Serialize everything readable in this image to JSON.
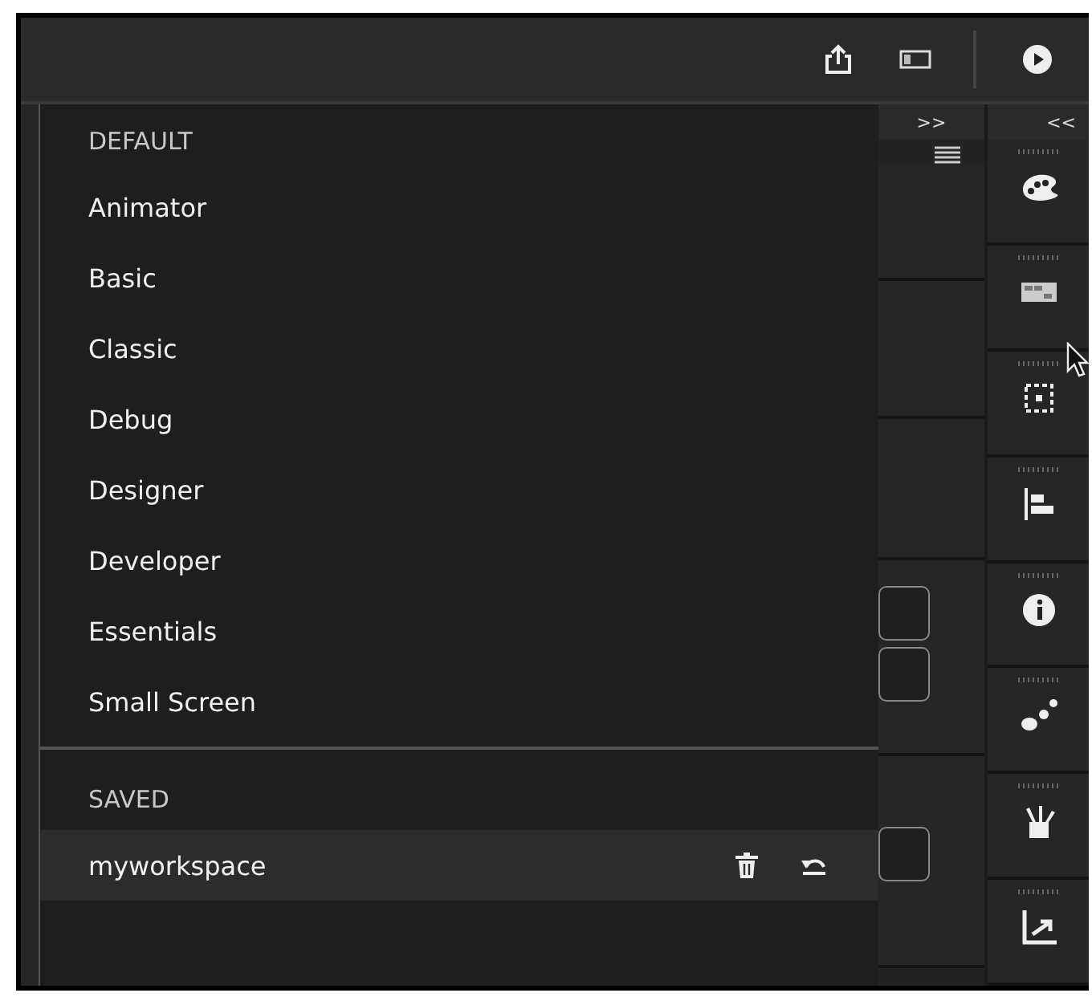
{
  "workspace_menu": {
    "sections": [
      {
        "heading": "DEFAULT",
        "items": [
          {
            "label": "Animator",
            "selected": false
          },
          {
            "label": "Basic",
            "selected": false
          },
          {
            "label": "Classic",
            "selected": false
          },
          {
            "label": "Debug",
            "selected": false
          },
          {
            "label": "Designer",
            "selected": false
          },
          {
            "label": "Developer",
            "selected": false
          },
          {
            "label": "Essentials",
            "selected": false
          },
          {
            "label": "Small Screen",
            "selected": false
          }
        ]
      },
      {
        "heading": "SAVED",
        "items": [
          {
            "label": "myworkspace",
            "selected": true,
            "kind": "custom"
          }
        ]
      }
    ]
  },
  "side_panel": {
    "expand_label": ">>"
  },
  "icon_dock": {
    "collapse_label": "<<"
  }
}
